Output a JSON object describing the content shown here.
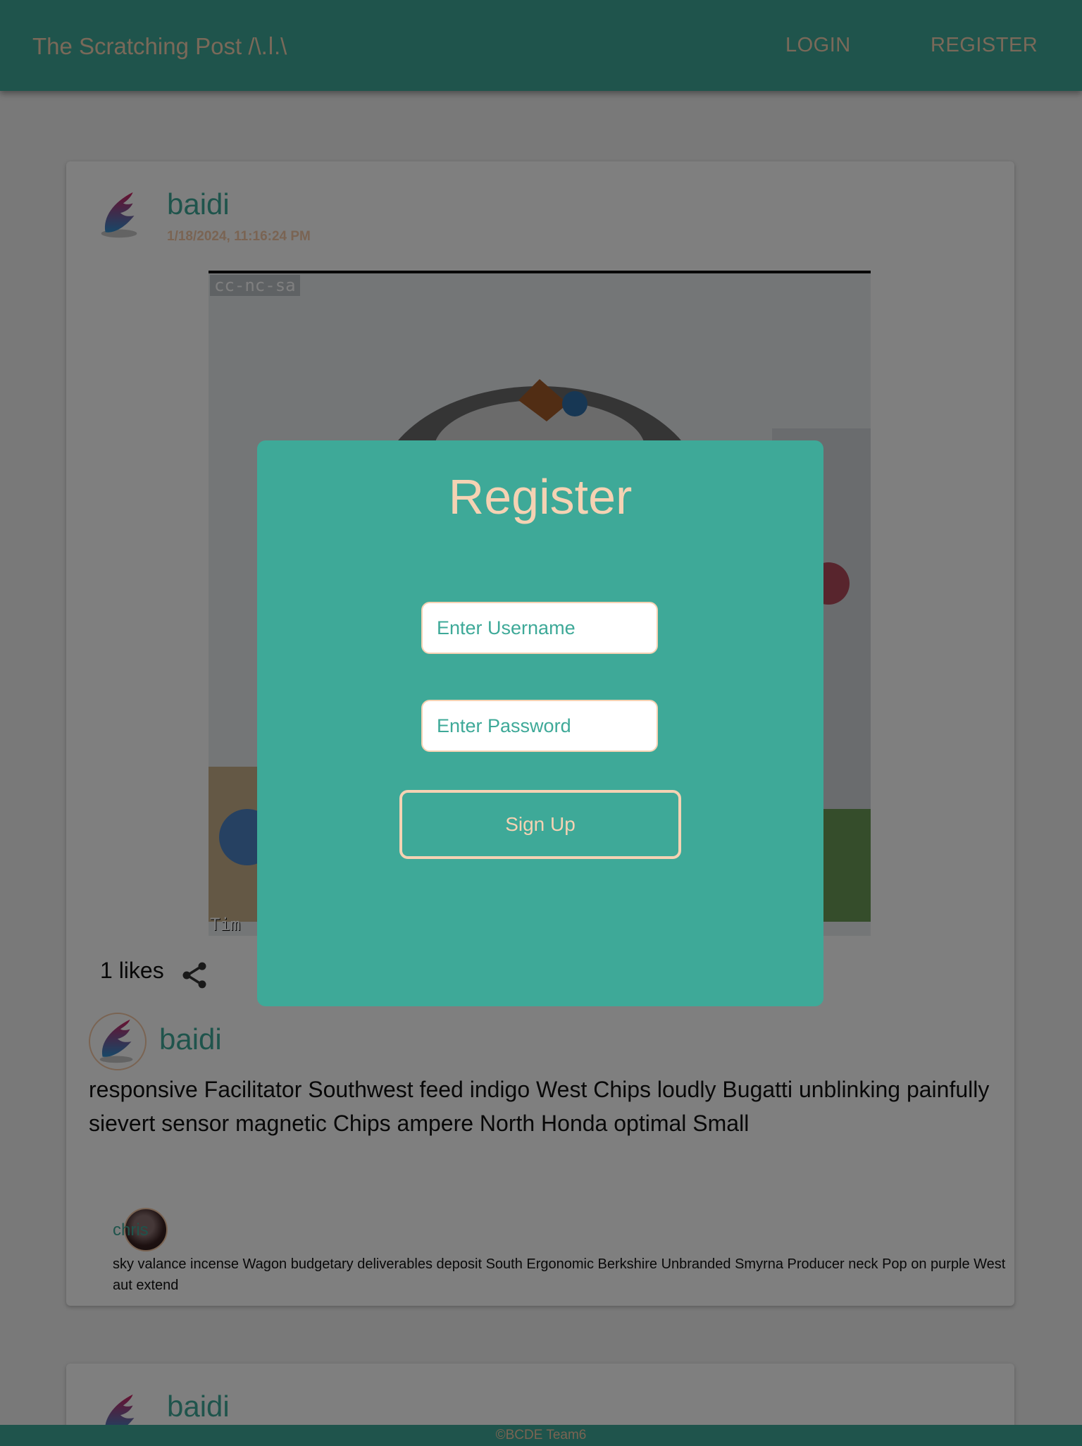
{
  "header": {
    "brand": "The Scratching Post /\\.ﺍ.\\",
    "nav": {
      "login": "LOGIN",
      "register": "REGISTER"
    }
  },
  "posts": [
    {
      "author": "baidi",
      "date": "1/18/2024, 11:16:24 PM",
      "image": {
        "watermark_top": "cc-nc-sa",
        "watermark_bottom": "Tim"
      },
      "likes": "1 likes",
      "comments": [
        {
          "author": "baidi",
          "text": "responsive Facilitator Southwest feed indigo West Chips loudly Bugatti unblinking painfully sievert sensor magnetic Chips ampere North Honda optimal Small",
          "replies": [
            {
              "author": "chris",
              "text": "sky valance incense Wagon budgetary deliverables deposit South Ergonomic Berkshire Unbranded Smyrna Producer neck Pop on purple West aut extend"
            }
          ]
        }
      ]
    },
    {
      "author": "baidi"
    }
  ],
  "modal": {
    "title": "Register",
    "username_placeholder": "Enter Username",
    "password_placeholder": "Enter Password",
    "submit_label": "Sign Up"
  },
  "footer": {
    "text": "©BCDE Team6"
  },
  "colors": {
    "primary": "#3ea998",
    "accent": "#f5d2b3",
    "overlay": "rgba(0,0,0,0.5)"
  },
  "icons": {
    "share": "share-icon",
    "avatar": "feather-avatar-icon"
  }
}
